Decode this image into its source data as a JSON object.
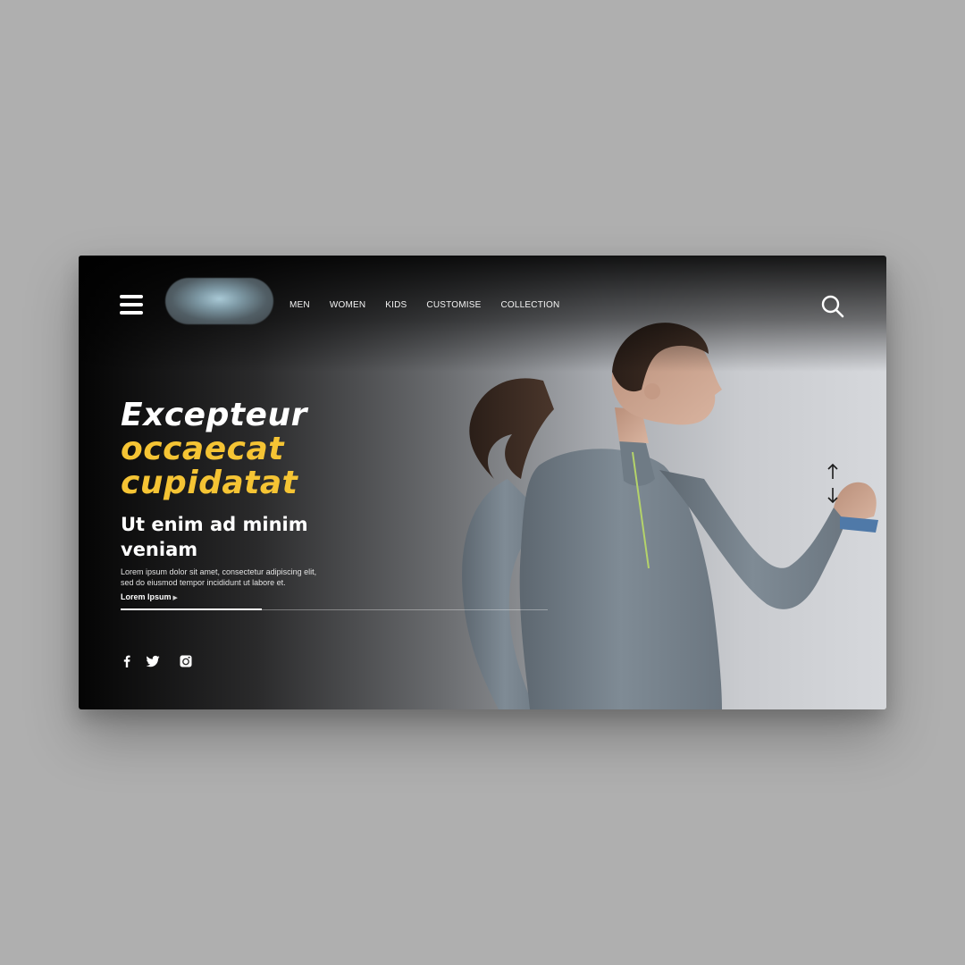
{
  "colors": {
    "accent": "#f5c434",
    "page_bg": "#afafaf",
    "text_light": "#ffffff"
  },
  "header": {
    "menu_icon": "hamburger-menu-icon",
    "nav": [
      "MEN",
      "WOMEN",
      "KIDS",
      "CUSTOMISE",
      "COLLECTION"
    ],
    "search_icon": "search-icon"
  },
  "hero": {
    "title_line1": "Excepteur",
    "title_line2": "occaecat",
    "title_line3": "cupidatat",
    "subtitle": "Ut enim ad minim veniam",
    "description": "Lorem ipsum dolor sit amet, consectetur adipiscing elit, sed do eiusmod tempor incididunt ut labore et.",
    "cta_label": "Lorem Ipsum",
    "slide_progress": 0.33
  },
  "social": [
    "facebook-icon",
    "twitter-icon",
    "instagram-icon"
  ],
  "scroll_controls": [
    "arrow-up-icon",
    "arrow-down-icon"
  ]
}
